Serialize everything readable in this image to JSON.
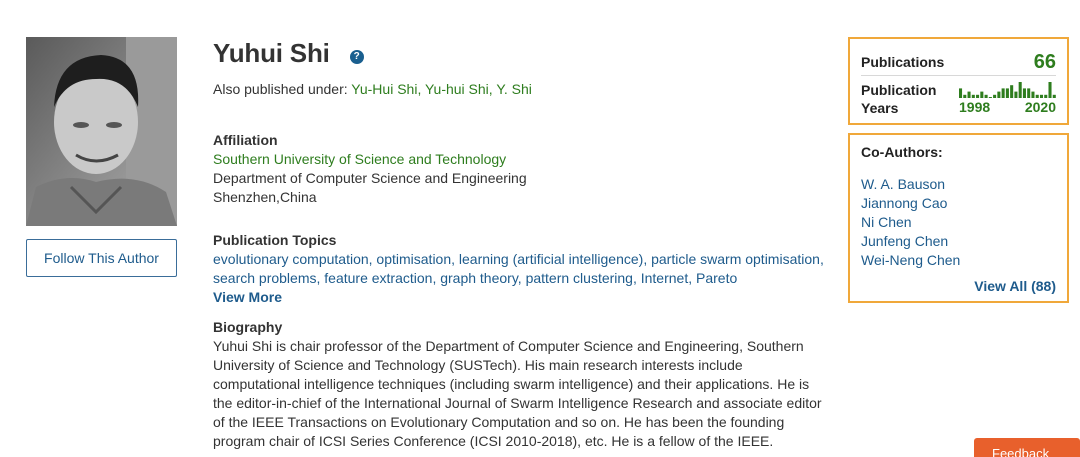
{
  "author": {
    "name": "Yuhui Shi",
    "also_published_prefix": "Also published under: ",
    "also_published_names": "Yu-Hui Shi, Yu-hui Shi, Y. Shi",
    "follow_label": "Follow This Author"
  },
  "affiliation": {
    "heading": "Affiliation",
    "institution": "Southern University of Science and Technology",
    "department": "Department of Computer Science and Engineering",
    "location": "Shenzhen,China"
  },
  "topics": {
    "heading": "Publication Topics",
    "text": "evolutionary computation, optimisation, learning (artificial intelligence), particle swarm optimisation, search problems, feature extraction, graph theory, pattern clustering, Internet, Pareto",
    "view_more": "View More"
  },
  "biography": {
    "heading": "Biography",
    "text": "Yuhui Shi is chair professor of the Department of Computer Science and Engineering, Southern University of Science and Technology (SUSTech). His main research interests include computational intelligence techniques (including swarm intelligence) and their applications. He is the editor-in-chief of the International Journal of Swarm Intelligence Research and associate editor of the IEEE Transactions on Evolutionary Computation and so on. He has been the founding program chair of ICSI Series Conference (ICSI 2010-2018), etc. He is a fellow of the IEEE."
  },
  "stats": {
    "publications_label": "Publications",
    "publications_count": "66",
    "years_label": "Publication Years",
    "year_start": "1998",
    "year_end": "2020",
    "year_histogram": [
      3,
      1,
      2,
      1,
      1,
      2,
      1,
      0,
      1,
      2,
      3,
      3,
      4,
      2,
      5,
      3,
      3,
      2,
      1,
      1,
      1,
      5,
      1
    ],
    "accent_color": "#2e7d1e",
    "border_color": "#f0a83a"
  },
  "coauthors": {
    "heading": "Co-Authors:",
    "names": [
      "W. A. Bauson",
      "Jiannong Cao",
      "Ni Chen",
      "Junfeng Chen",
      "Wei-Neng Chen"
    ],
    "view_all": "View All (88)"
  },
  "icons": {
    "help": "help-circle-icon"
  },
  "feedback": {
    "label": "Feedback"
  }
}
